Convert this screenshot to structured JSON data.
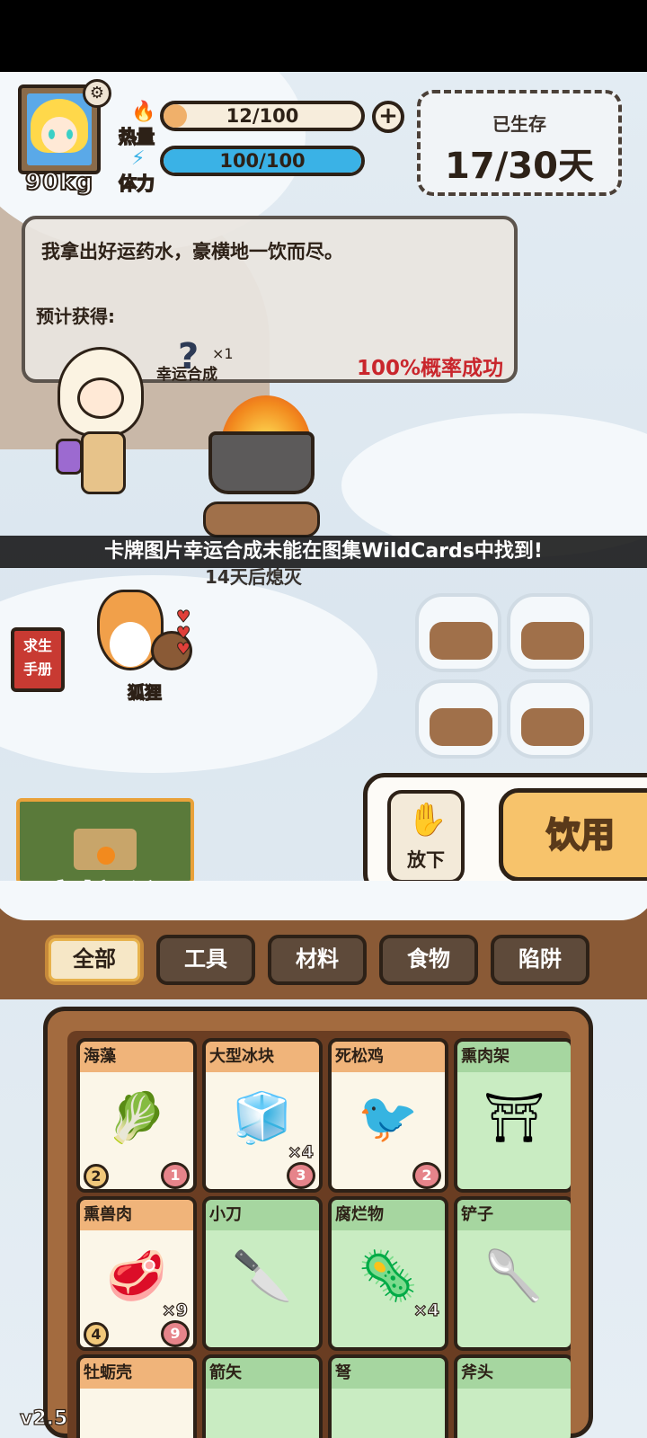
{
  "player": {
    "weight": "90kg",
    "heat_label": "热量",
    "stamina_label": "体力",
    "heat_value": "12/100",
    "heat_fraction": 0.12,
    "stamina_value": "100/100",
    "stamina_fraction": 1.0
  },
  "survival": {
    "title": "已生存",
    "days": "17/30天"
  },
  "dialog": {
    "text": "我拿出好运药水，豪横地一饮而尽。",
    "expected_label": "预计获得:",
    "reward_icon": "?",
    "reward_qty": "×1",
    "reward_name": "幸运合成",
    "chance": "100%概率成功"
  },
  "banner": "卡牌图片幸运合成未能在图集WildCards中找到!",
  "fire_caption": "14天后熄灭",
  "manual_label": "求生\n手册",
  "fox_label": "狐狸",
  "shelter_label": "庇护所",
  "actions": {
    "drop_label": "放下",
    "use_label": "饮用"
  },
  "tabs": [
    {
      "label": "全部",
      "active": true
    },
    {
      "label": "工具",
      "active": false
    },
    {
      "label": "材料",
      "active": false
    },
    {
      "label": "食物",
      "active": false
    },
    {
      "label": "陷阱",
      "active": false
    }
  ],
  "inventory": [
    {
      "name": "海藻",
      "icon": "seaweed-icon",
      "glyph": "🥬",
      "qty": "",
      "left": "2",
      "right": "1",
      "kind": "food"
    },
    {
      "name": "大型冰块",
      "icon": "ice-block-icon",
      "glyph": "🧊",
      "qty": "×4",
      "left": "",
      "right": "3",
      "kind": "food"
    },
    {
      "name": "死松鸡",
      "icon": "dead-grouse-icon",
      "glyph": "🐦",
      "qty": "",
      "left": "",
      "right": "2",
      "kind": "food"
    },
    {
      "name": "熏肉架",
      "icon": "smoking-rack-icon",
      "glyph": "⛩",
      "qty": "",
      "left": "",
      "right": "",
      "kind": "tool"
    },
    {
      "name": "熏兽肉",
      "icon": "smoked-meat-icon",
      "glyph": "🥩",
      "qty": "×9",
      "left": "4",
      "right": "9",
      "kind": "food"
    },
    {
      "name": "小刀",
      "icon": "knife-icon",
      "glyph": "🔪",
      "qty": "",
      "left": "",
      "right": "",
      "kind": "tool"
    },
    {
      "name": "腐烂物",
      "icon": "rotten-stuff-icon",
      "glyph": "🦠",
      "qty": "×4",
      "left": "",
      "right": "",
      "kind": "tool"
    },
    {
      "name": "铲子",
      "icon": "shovel-icon",
      "glyph": "🥄",
      "qty": "",
      "left": "",
      "right": "",
      "kind": "tool"
    },
    {
      "name": "牡蛎壳",
      "icon": "oyster-shell-icon",
      "glyph": "",
      "qty": "",
      "left": "",
      "right": "",
      "kind": "food"
    },
    {
      "name": "箭矢",
      "icon": "arrow-icon",
      "glyph": "",
      "qty": "",
      "left": "",
      "right": "",
      "kind": "tool"
    },
    {
      "name": "弩",
      "icon": "crossbow-icon",
      "glyph": "",
      "qty": "",
      "left": "",
      "right": "",
      "kind": "tool"
    },
    {
      "name": "斧头",
      "icon": "axe-icon",
      "glyph": "",
      "qty": "",
      "left": "",
      "right": "",
      "kind": "tool"
    }
  ],
  "version": "v2.5",
  "colors": {
    "heat_bar": "#f0b06a",
    "stamina_bar": "#3ab2e6",
    "food_card_head": "#f0b47a",
    "tool_card_head": "#a6d6a0",
    "card_body": "#fbf6e8",
    "tool_card_body": "#c9ecc2",
    "chance_red": "#c9262c"
  }
}
